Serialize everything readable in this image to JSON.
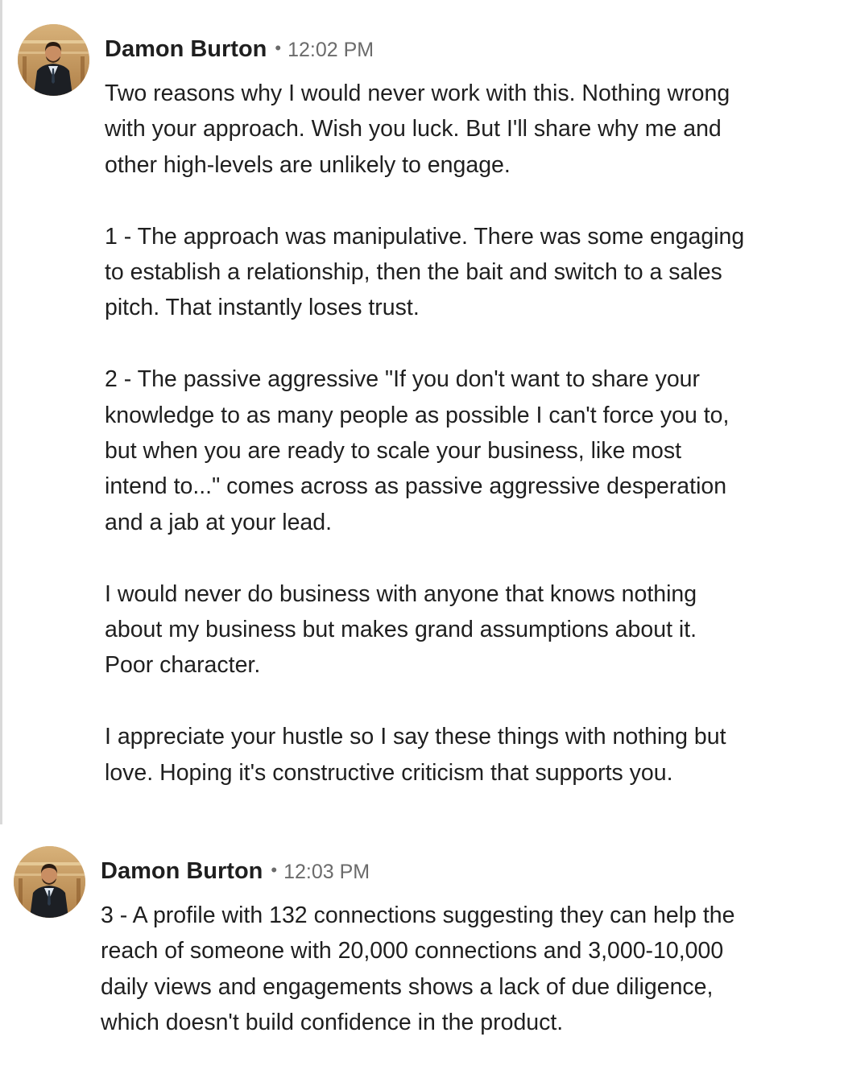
{
  "messages": [
    {
      "author": "Damon Burton",
      "separator": "•",
      "time": "12:02 PM",
      "avatar_icon": "person-avatar-icon",
      "paragraphs": [
        {
          "lines": [
            "Two reasons why I would never work with this.  Nothing wrong",
            "with your approach.  Wish you luck.  But I'll share why me and",
            "other high-levels are unlikely to engage."
          ]
        },
        {
          "lines": [
            "1 - The approach was manipulative.  There was some engaging",
            "to establish a relationship, then the bait and switch to a sales",
            "pitch.  That instantly loses trust."
          ]
        },
        {
          "lines": [
            "2 - The passive aggressive \"If you don't want to share your",
            "knowledge to as many people as possible I can't force you to,",
            "but when you are ready to scale your business, like most",
            "intend to...\" comes across as passive aggressive desperation",
            "and a jab at your lead."
          ]
        },
        {
          "lines": [
            "I would never do business with anyone that knows nothing",
            "about my business but makes grand assumptions about it.",
            "Poor character."
          ]
        },
        {
          "lines": [
            "I appreciate your hustle so I say these things with nothing but",
            "love. Hoping it's constructive criticism that supports you."
          ]
        }
      ]
    },
    {
      "author": "Damon Burton",
      "separator": "•",
      "time": "12:03 PM",
      "avatar_icon": "person-avatar-icon",
      "paragraphs": [
        {
          "lines": [
            "3 - A profile with 132 connections suggesting they can help the",
            "reach of someone with 20,000 connections and 3,000-10,000",
            "daily views and engagements shows a lack of due diligence,",
            "which doesn't build confidence in the product."
          ]
        }
      ]
    }
  ],
  "colors": {
    "text": "#1f1f1f",
    "meta": "#6b6b6b",
    "rule": "#d9d9d9"
  }
}
